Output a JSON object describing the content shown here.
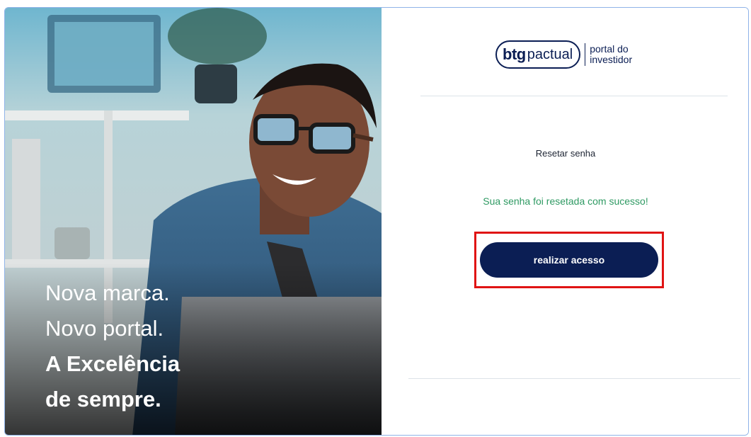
{
  "hero": {
    "line1": "Nova marca.",
    "line2": "Novo portal.",
    "line3": "A Excelência",
    "line4": "de sempre."
  },
  "logo": {
    "brand_bold": "btg",
    "brand_light": "pactual",
    "sub_line1": "portal do",
    "sub_line2": "investidor"
  },
  "form": {
    "title": "Resetar senha",
    "success_message": "Sua senha foi resetada com sucesso!",
    "button_label": "realizar acesso"
  },
  "colors": {
    "brand_navy": "#0b1e54",
    "success_green": "#2f9a63",
    "highlight_red": "#e01414"
  }
}
